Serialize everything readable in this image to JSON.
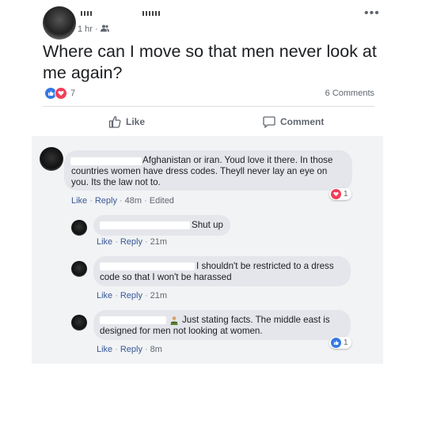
{
  "post": {
    "time": "1 hr · ",
    "text": "Where can I move so that men never look at me again?",
    "reaction_count": "7",
    "comments_count": "6 Comments",
    "more_icon": "more-dots-icon"
  },
  "actions": {
    "like_label": "Like",
    "comment_label": "Comment"
  },
  "comments": [
    {
      "text": "Afghanistan or iran. Youd love it there. In those countries women have dress codes. Theyll never lay an eye on you. Its the law not to.",
      "like": "Like",
      "reply": "Reply",
      "time": "48m",
      "edited": "Edited",
      "reaction_count": "1"
    },
    {
      "text": "Shut up",
      "like": "Like",
      "reply": "Reply",
      "time": "21m"
    },
    {
      "text": "I shouldn't be restricted to a dress code so that I won't be harassed",
      "like": "Like",
      "reply": "Reply",
      "time": "21m"
    },
    {
      "text": "Just stating facts. The middle east is designed for men not looking at women.",
      "like": "Like",
      "reply": "Reply",
      "time": "8m",
      "reaction_count": "1"
    }
  ],
  "colors": {
    "link": "#385898",
    "like_blue": "#3578e5",
    "love_red": "#f33e58",
    "bubble": "#e4e6eb"
  }
}
